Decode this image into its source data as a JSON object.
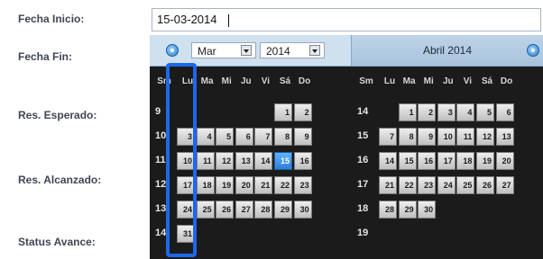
{
  "form": {
    "labels": {
      "fecha_inicio": "Fecha Inicio:",
      "fecha_fin": "Fecha Fin:",
      "res_esperado": "Res. Esperado:",
      "res_alcanzado": "Res. Alcanzado:",
      "status_avance": "Status Avance:"
    },
    "fecha_inicio_value": "15-03-2014"
  },
  "calendar": {
    "month_select": "Mar",
    "year_select": "2014",
    "right_title": "Abril 2014",
    "dow_left": [
      "Sm",
      "Lu",
      "Ma",
      "Mi",
      "Ju",
      "Vi",
      "Sá",
      "Do"
    ],
    "dow_right": [
      "Sm",
      "Lu",
      "Ma",
      "Mi",
      "Ju",
      "Vi",
      "Sá",
      "Do"
    ],
    "left_weeks": [
      {
        "wk": "9",
        "days": [
          "",
          "",
          "",
          "",
          "",
          "1",
          "2"
        ]
      },
      {
        "wk": "10",
        "days": [
          "3",
          "4",
          "5",
          "6",
          "7",
          "8",
          "9"
        ]
      },
      {
        "wk": "11",
        "days": [
          "10",
          "11",
          "12",
          "13",
          "14",
          "15",
          "16"
        ]
      },
      {
        "wk": "12",
        "days": [
          "17",
          "18",
          "19",
          "20",
          "21",
          "22",
          "23"
        ]
      },
      {
        "wk": "13",
        "days": [
          "24",
          "25",
          "26",
          "27",
          "28",
          "29",
          "30"
        ]
      },
      {
        "wk": "14",
        "days": [
          "31",
          "",
          "",
          "",
          "",
          "",
          ""
        ]
      }
    ],
    "right_weeks": [
      {
        "wk": "14",
        "days": [
          "",
          "1",
          "2",
          "3",
          "4",
          "5",
          "6"
        ]
      },
      {
        "wk": "15",
        "days": [
          "7",
          "8",
          "9",
          "10",
          "11",
          "12",
          "13"
        ]
      },
      {
        "wk": "16",
        "days": [
          "14",
          "15",
          "16",
          "17",
          "18",
          "19",
          "20"
        ]
      },
      {
        "wk": "17",
        "days": [
          "21",
          "22",
          "23",
          "24",
          "25",
          "26",
          "27"
        ]
      },
      {
        "wk": "18",
        "days": [
          "28",
          "29",
          "30",
          "",
          "",
          "",
          ""
        ]
      },
      {
        "wk": "19",
        "days": [
          "",
          "",
          "",
          "",
          "",
          "",
          ""
        ]
      }
    ],
    "selected_day": "15",
    "colors": {
      "accent": "#1d67ea",
      "today": "#2c7fd6"
    }
  }
}
